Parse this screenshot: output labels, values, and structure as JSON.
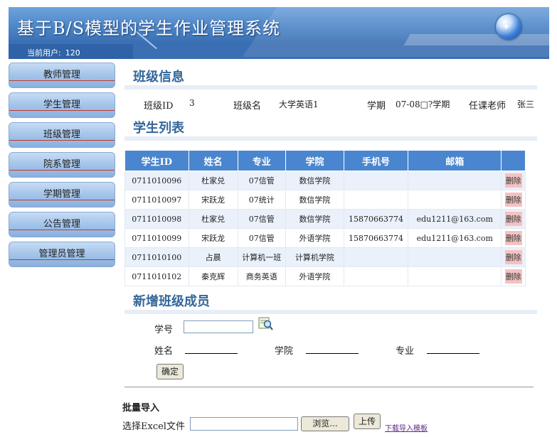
{
  "header": {
    "title": "基于B/S模型的学生作业管理系统",
    "current_user_label": "当前用户:",
    "current_user_value": "120"
  },
  "sidebar": {
    "items": [
      {
        "label": "教师管理"
      },
      {
        "label": "学生管理"
      },
      {
        "label": "班级管理"
      },
      {
        "label": "院系管理"
      },
      {
        "label": "学期管理"
      },
      {
        "label": "公告管理"
      },
      {
        "label": "管理员管理"
      }
    ]
  },
  "class_info": {
    "section_title": "班级信息",
    "id_label": "班级ID",
    "id_value": "3",
    "name_label": "班级名",
    "name_value": "大学英语1",
    "term_label": "学期",
    "term_value": "07-08□?学期",
    "teacher_label": "任课老师",
    "teacher_value": "张三"
  },
  "student_list": {
    "section_title": "学生列表",
    "columns": [
      "学生ID",
      "姓名",
      "专业",
      "学院",
      "手机号",
      "邮箱",
      ""
    ],
    "delete_label": "删除",
    "rows": [
      [
        "0711010096",
        "杜家兑",
        "07信管",
        "数信学院",
        "",
        ""
      ],
      [
        "0711010097",
        "宋跃龙",
        "07统计",
        "数信学院",
        "",
        ""
      ],
      [
        "0711010098",
        "杜家兑",
        "07信管",
        "数信学院",
        "15870663774",
        "edu1211@163.com"
      ],
      [
        "0711010099",
        "宋跃龙",
        "07信管",
        "外语学院",
        "15870663774",
        "edu1211@163.com"
      ],
      [
        "0711010100",
        "占晨",
        "计算机一班",
        "计算机学院",
        "",
        ""
      ],
      [
        "0711010102",
        "秦克辉",
        "商务英语",
        "外语学院",
        "",
        ""
      ]
    ]
  },
  "new_member": {
    "section_title": "新增班级成员",
    "student_no_label": "学号",
    "student_no_value": "",
    "name_label": "姓名",
    "college_label": "学院",
    "major_label": "专业",
    "confirm_label": "确定"
  },
  "bulk_import": {
    "title": "批量导入",
    "file_label": "选择Excel文件",
    "browse_label": "浏览...",
    "upload_label": "上传",
    "download_link": "下载导入模板"
  },
  "icons": {
    "search": "search-icon",
    "globe": "globe-logo-icon"
  }
}
